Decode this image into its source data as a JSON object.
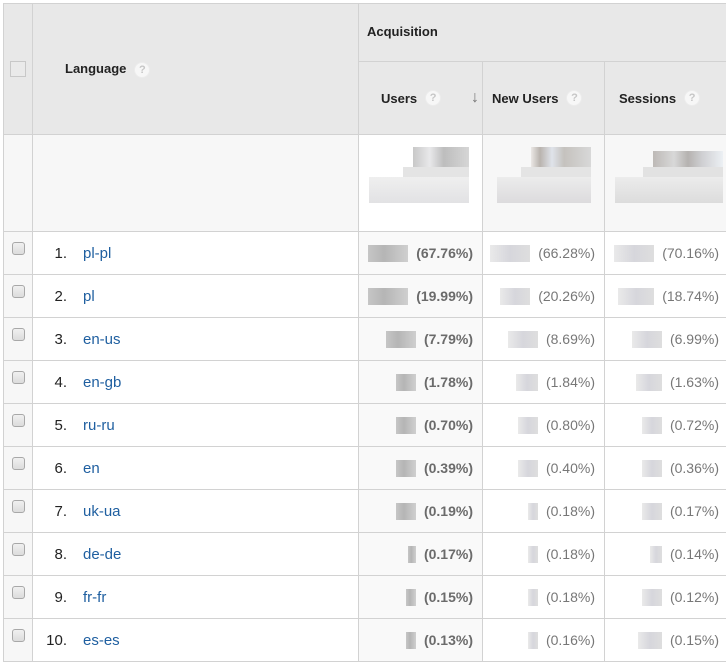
{
  "table": {
    "dimension_header": "Language",
    "group_header": "Acquisition",
    "metrics": [
      {
        "key": "users",
        "label": "Users",
        "sorted": true,
        "sort_direction": "descending"
      },
      {
        "key": "new_users",
        "label": "New Users",
        "sorted": false
      },
      {
        "key": "sessions",
        "label": "Sessions",
        "sorted": false
      }
    ],
    "help_icon": "?",
    "sort_icon": "↓",
    "totals": {
      "users": "redacted",
      "new_users": "redacted",
      "sessions": "redacted"
    },
    "rows": [
      {
        "rank": "1.",
        "language": "pl-pl",
        "users_pct": "(67.76%)",
        "new_users_pct": "(66.28%)",
        "sessions_pct": "(70.16%)"
      },
      {
        "rank": "2.",
        "language": "pl",
        "users_pct": "(19.99%)",
        "new_users_pct": "(20.26%)",
        "sessions_pct": "(18.74%)"
      },
      {
        "rank": "3.",
        "language": "en-us",
        "users_pct": "(7.79%)",
        "new_users_pct": "(8.69%)",
        "sessions_pct": "(6.99%)"
      },
      {
        "rank": "4.",
        "language": "en-gb",
        "users_pct": "(1.78%)",
        "new_users_pct": "(1.84%)",
        "sessions_pct": "(1.63%)"
      },
      {
        "rank": "5.",
        "language": "ru-ru",
        "users_pct": "(0.70%)",
        "new_users_pct": "(0.80%)",
        "sessions_pct": "(0.72%)"
      },
      {
        "rank": "6.",
        "language": "en",
        "users_pct": "(0.39%)",
        "new_users_pct": "(0.40%)",
        "sessions_pct": "(0.36%)"
      },
      {
        "rank": "7.",
        "language": "uk-ua",
        "users_pct": "(0.19%)",
        "new_users_pct": "(0.18%)",
        "sessions_pct": "(0.17%)"
      },
      {
        "rank": "8.",
        "language": "de-de",
        "users_pct": "(0.17%)",
        "new_users_pct": "(0.18%)",
        "sessions_pct": "(0.14%)"
      },
      {
        "rank": "9.",
        "language": "fr-fr",
        "users_pct": "(0.15%)",
        "new_users_pct": "(0.18%)",
        "sessions_pct": "(0.12%)"
      },
      {
        "rank": "10.",
        "language": "es-es",
        "users_pct": "(0.13%)",
        "new_users_pct": "(0.16%)",
        "sessions_pct": "(0.15%)"
      }
    ]
  }
}
